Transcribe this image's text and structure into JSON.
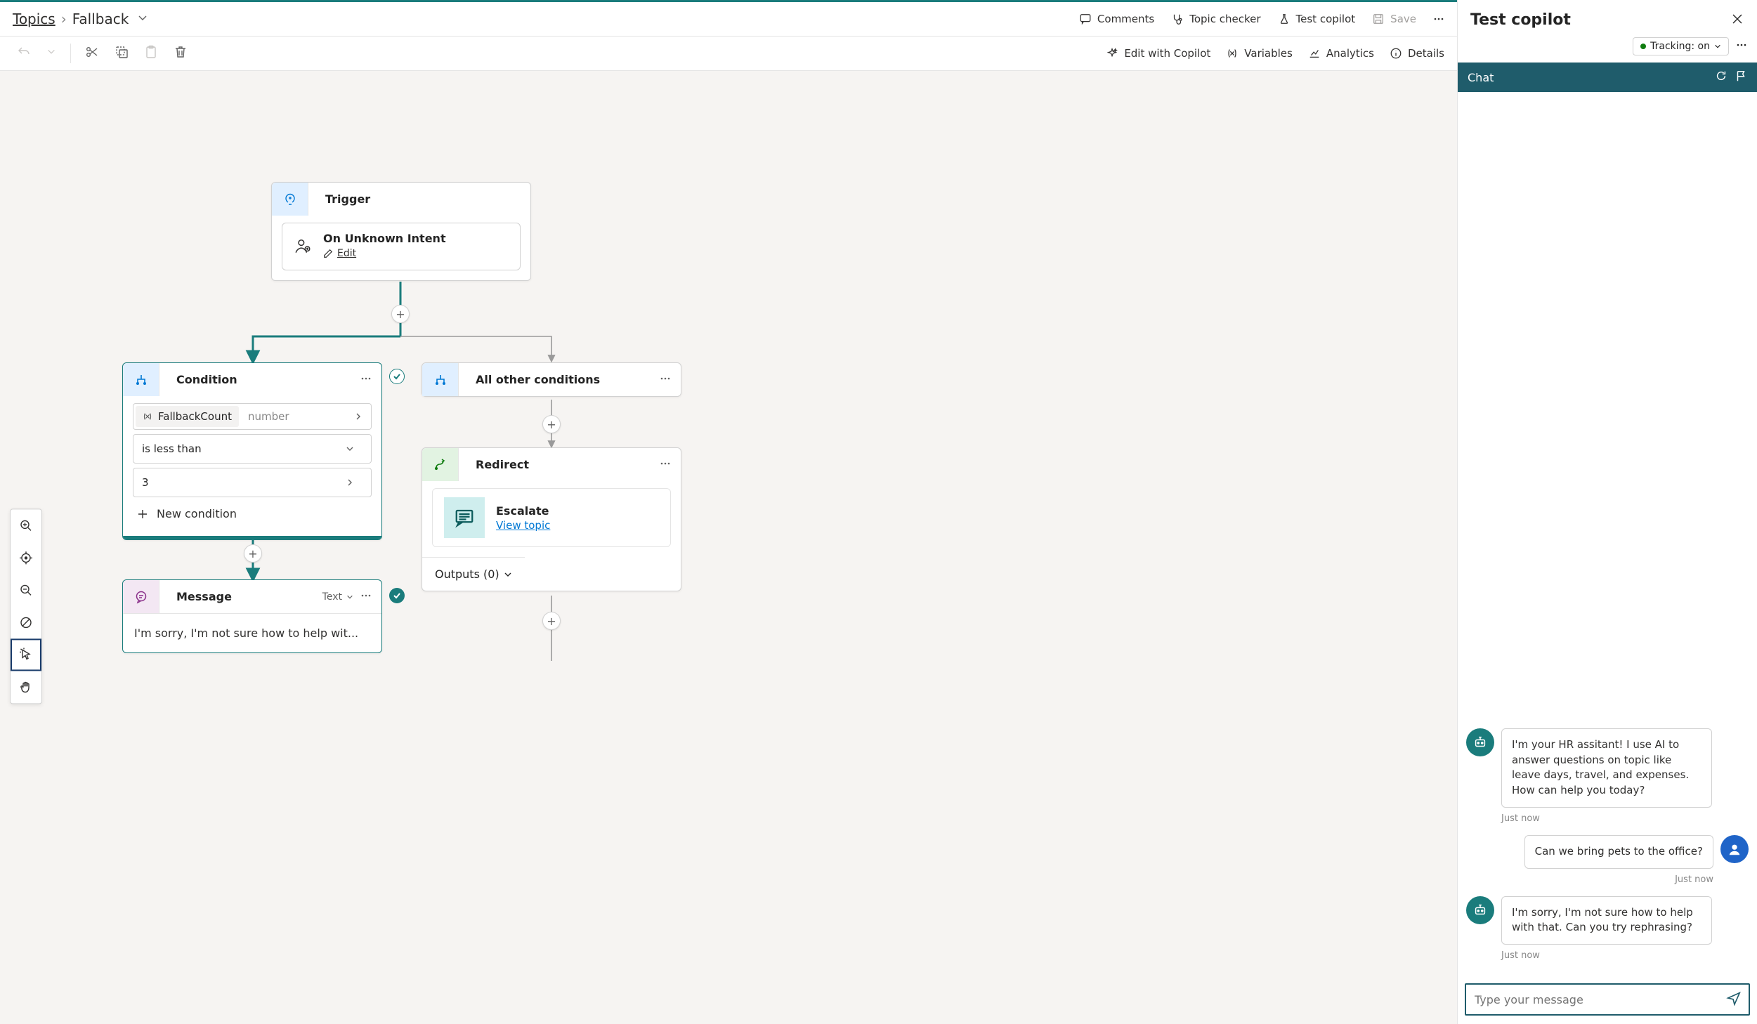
{
  "breadcrumb": {
    "root": "Topics",
    "current": "Fallback"
  },
  "top_actions": {
    "comments": "Comments",
    "topic_checker": "Topic checker",
    "test_copilot": "Test copilot",
    "save": "Save"
  },
  "toolbar2": {
    "edit_with_copilot": "Edit with Copilot",
    "variables": "Variables",
    "analytics": "Analytics",
    "details": "Details"
  },
  "trigger": {
    "title": "Trigger",
    "event_title": "On Unknown Intent",
    "edit": "Edit"
  },
  "condition": {
    "title": "Condition",
    "variable": "FallbackCount",
    "var_type": "number",
    "operator": "is less than",
    "value": "3",
    "new_condition": "New condition"
  },
  "all_other": {
    "title": "All other conditions"
  },
  "redirect": {
    "title": "Redirect",
    "target": "Escalate",
    "view_topic": "View topic",
    "outputs_label": "Outputs (0)"
  },
  "message": {
    "title": "Message",
    "type_label": "Text",
    "preview": "I'm sorry, I'm not sure how to help wit..."
  },
  "panel": {
    "title": "Test copilot",
    "tracking": "Tracking: on",
    "chat": "Chat"
  },
  "chat": {
    "bot1": "I'm your HR assitant! I use AI to answer questions on topic like leave days, travel, and expenses. How can help you today?",
    "ts1": "Just now",
    "user1": "Can we bring pets to the office?",
    "ts2": "Just now",
    "bot2": "I'm sorry, I'm not sure how to help with that. Can you try rephrasing?",
    "ts3": "Just now",
    "placeholder": "Type your message"
  }
}
